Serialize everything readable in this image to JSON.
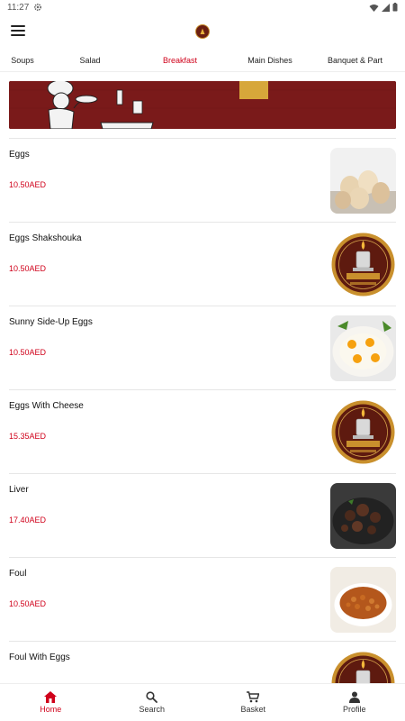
{
  "status_bar": {
    "time": "11:27"
  },
  "tabs": [
    {
      "label": "Soups"
    },
    {
      "label": "Salad"
    },
    {
      "label": "Breakfast"
    },
    {
      "label": "Main Dishes"
    },
    {
      "label": "Banquet & Part"
    }
  ],
  "active_tab": "Breakfast",
  "items": [
    {
      "name": "Eggs",
      "price": "10.50AED",
      "image": "eggs-photo"
    },
    {
      "name": "Eggs Shakshouka",
      "price": "10.50AED",
      "image": "restaurant-logo"
    },
    {
      "name": "Sunny Side-Up Eggs",
      "price": "10.50AED",
      "image": "fried-eggs-photo"
    },
    {
      "name": "Eggs With Cheese",
      "price": "15.35AED",
      "image": "restaurant-logo"
    },
    {
      "name": "Liver",
      "price": "17.40AED",
      "image": "liver-photo"
    },
    {
      "name": "Foul",
      "price": "10.50AED",
      "image": "foul-photo"
    },
    {
      "name": "Foul With Eggs",
      "price": "",
      "image": "restaurant-logo"
    }
  ],
  "bottom_nav": [
    {
      "label": "Home",
      "icon": "home-icon"
    },
    {
      "label": "Search",
      "icon": "search-icon"
    },
    {
      "label": "Basket",
      "icon": "cart-icon"
    },
    {
      "label": "Profile",
      "icon": "person-icon"
    }
  ],
  "colors": {
    "accent": "#d0021b",
    "banner": "#7a1a1a",
    "logo_bg": "#6b1f12",
    "logo_gold": "#c9902d"
  }
}
